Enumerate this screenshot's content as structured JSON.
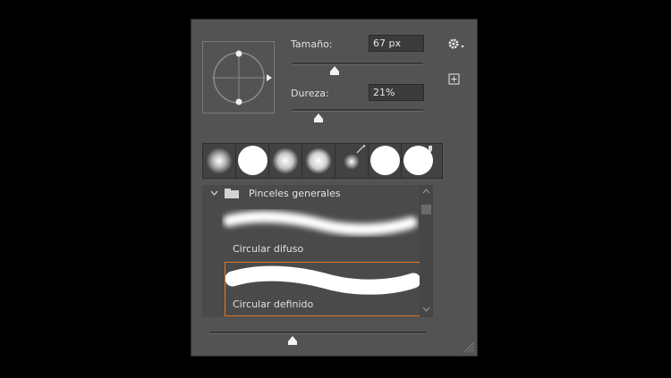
{
  "size": {
    "label": "Tamaño:",
    "value": "67 px",
    "level_percent": 34
  },
  "hardness": {
    "label": "Dureza:",
    "value": "21%",
    "level_percent": 21
  },
  "icons": {
    "settings": "gear-icon",
    "new_preset": "plus-square-icon",
    "angle_preview": "brush-angle-preview-icon",
    "expand": "chevron-down-icon",
    "folder": "folder-icon",
    "resize": "resize-grip-icon"
  },
  "presets_group": {
    "name": "Pinceles generales"
  },
  "brushes": [
    {
      "name": "Circular difuso"
    },
    {
      "name": "Circular definido",
      "selected": true
    }
  ],
  "preview_size_level_percent": 38,
  "colors": {
    "panel": "#535353",
    "selection": "#e0782b",
    "background": "#000000"
  }
}
